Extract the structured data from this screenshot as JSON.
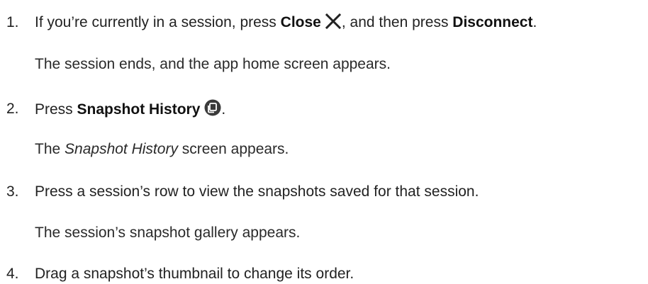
{
  "steps": [
    {
      "number": "1.",
      "before": "If you’re currently in a session, press ",
      "button1": "Close",
      "icon1": "close-x-icon",
      "middle": ", and then press ",
      "button2": "Disconnect",
      "after": ".",
      "result": "The session ends, and the app home screen appears."
    },
    {
      "number": "2.",
      "before": "Press ",
      "button1": "Snapshot History",
      "icon1": "snapshot-history-icon",
      "after": ".",
      "result_italic": "Snapshot History",
      "result_rest": " screen appears.",
      "result_prefix": "The "
    },
    {
      "number": "3.",
      "text": "Press a session’s row to view the snapshots saved for that session.",
      "result": "The session’s snapshot gallery appears."
    },
    {
      "number": "4.",
      "text": "Drag a snapshot’s thumbnail to change its order."
    }
  ]
}
